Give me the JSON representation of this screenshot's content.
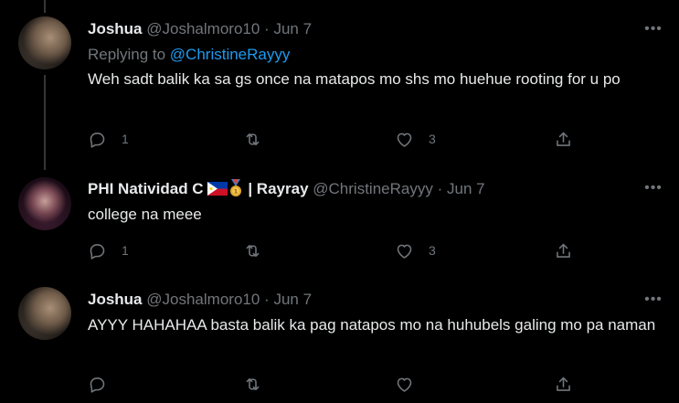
{
  "tweets": [
    {
      "name": "Joshua",
      "handle": "@Joshalmoro10",
      "separator": "·",
      "date": "Jun 7",
      "reply_prefix": "Replying to",
      "reply_mention": "@ChristineRayyy",
      "text": "Weh sadt balik ka sa gs once na matapos mo shs mo huehue rooting for u po",
      "reply_count": "1",
      "retweet_count": "",
      "like_count": "3"
    },
    {
      "name": "PHI Natividad C",
      "name_suffix": "| Rayray",
      "handle": "@ChristineRayyy",
      "separator": "·",
      "date": "Jun 7",
      "text": "college na meee",
      "reply_count": "1",
      "retweet_count": "",
      "like_count": "3"
    },
    {
      "name": "Joshua",
      "handle": "@Joshalmoro10",
      "separator": "·",
      "date": "Jun 7",
      "text": "AYYY HAHAHAA basta balik ka pag natapos mo na huhubels galing mo pa naman",
      "reply_count": "",
      "retweet_count": "",
      "like_count": ""
    }
  ],
  "more_label": "•••",
  "icons": {
    "reply": "reply-icon",
    "retweet": "retweet-icon",
    "like": "heart-icon",
    "share": "share-icon",
    "more": "more-options-icon",
    "flag": "philippines-flag-icon",
    "medal": "medal-icon"
  },
  "colors": {
    "background": "#000000",
    "text": "#e7e9ea",
    "secondary": "#71767b",
    "link": "#1d9bf0",
    "thread_line": "#333639"
  }
}
